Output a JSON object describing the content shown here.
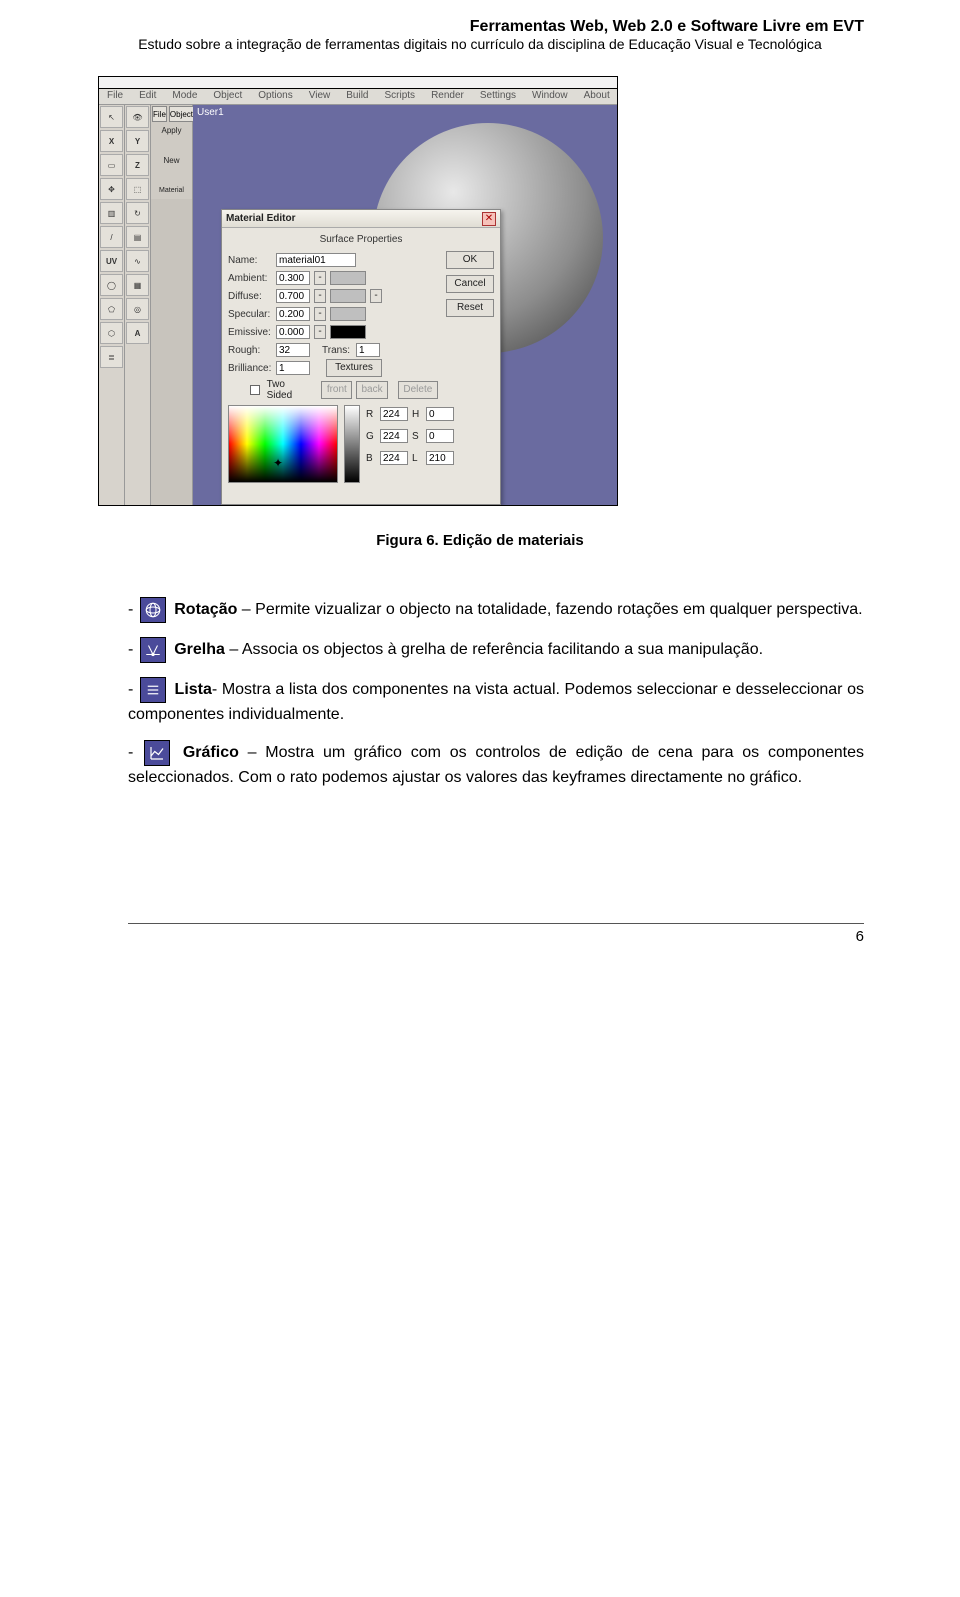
{
  "header": {
    "title": "Ferramentas Web, Web 2.0 e Software Livre em EVT",
    "subtitle": "Estudo sobre a integração de ferramentas digitais no currículo da disciplina de Educação Visual e Tecnológica"
  },
  "app": {
    "menubar": [
      "File",
      "Edit",
      "Mode",
      "Object",
      "Options",
      "View",
      "Build",
      "Scripts",
      "Render",
      "Settings",
      "Window",
      "About"
    ],
    "midcol": {
      "tab_file": "File",
      "tab_object": "Object",
      "apply": "Apply",
      "new": "New",
      "material_name": "Material Name"
    },
    "viewport_label": "User1",
    "tools": {
      "pointer": "↖",
      "eye": "👁",
      "x": "X",
      "y": "Y",
      "z": "Z",
      "select": "▭",
      "marquee": "⬚",
      "move": "✥",
      "rotate": "↻",
      "scale1": "▥",
      "scale2": "▤",
      "line": "/",
      "curve": "∿",
      "uv": "UV",
      "sphere": "◯",
      "grid": "▦",
      "poly": "⬠",
      "ring": "◎",
      "hex": "⬡",
      "a": "A",
      "list": "≣"
    }
  },
  "material_editor": {
    "title": "Material Editor",
    "subtitle": "Surface Properties",
    "labels": {
      "name": "Name:",
      "ambient": "Ambient:",
      "diffuse": "Diffuse:",
      "specular": "Specular:",
      "emissive": "Emissive:",
      "rough": "Rough:",
      "trans": "Trans:",
      "brilliance": "Brilliance:",
      "two_sided": "Two Sided",
      "r": "R",
      "g": "G",
      "b": "B",
      "h": "H",
      "s": "S",
      "l": "L"
    },
    "values": {
      "name": "material01",
      "ambient": "0.300",
      "diffuse": "0.700",
      "specular": "0.200",
      "emissive": "0.000",
      "rough": "32",
      "trans": "1",
      "brilliance": "1",
      "r": "224",
      "g": "224",
      "b": "224",
      "h": "0",
      "s": "0",
      "l": "210"
    },
    "buttons": {
      "ok": "OK",
      "cancel": "Cancel",
      "reset": "Reset",
      "textures": "Textures",
      "front": "front",
      "back": "back",
      "delete": "Delete"
    }
  },
  "figure": {
    "caption": "Figura 6. Edição de materiais"
  },
  "bullets": {
    "b1_term": "Rotação",
    "b1_text": " – Permite vizualizar o objecto na totalidade, fazendo rotações em qualquer perspectiva.",
    "b2_term": "Grelha",
    "b2_text": " – Associa os objectos à grelha de referência facilitando a sua manipulação.",
    "b3_term": "Lista",
    "b3_text": "- Mostra a lista dos componentes na vista actual. Podemos seleccionar e desseleccionar os componentes individualmente.",
    "b4_term": "Gráfico",
    "b4_text": " – Mostra um gráfico com os controlos de edição de cena para os componentes seleccionados. Com o rato podemos ajustar os valores das keyframes directamente no gráfico."
  },
  "page_number": "6",
  "dash": "- "
}
